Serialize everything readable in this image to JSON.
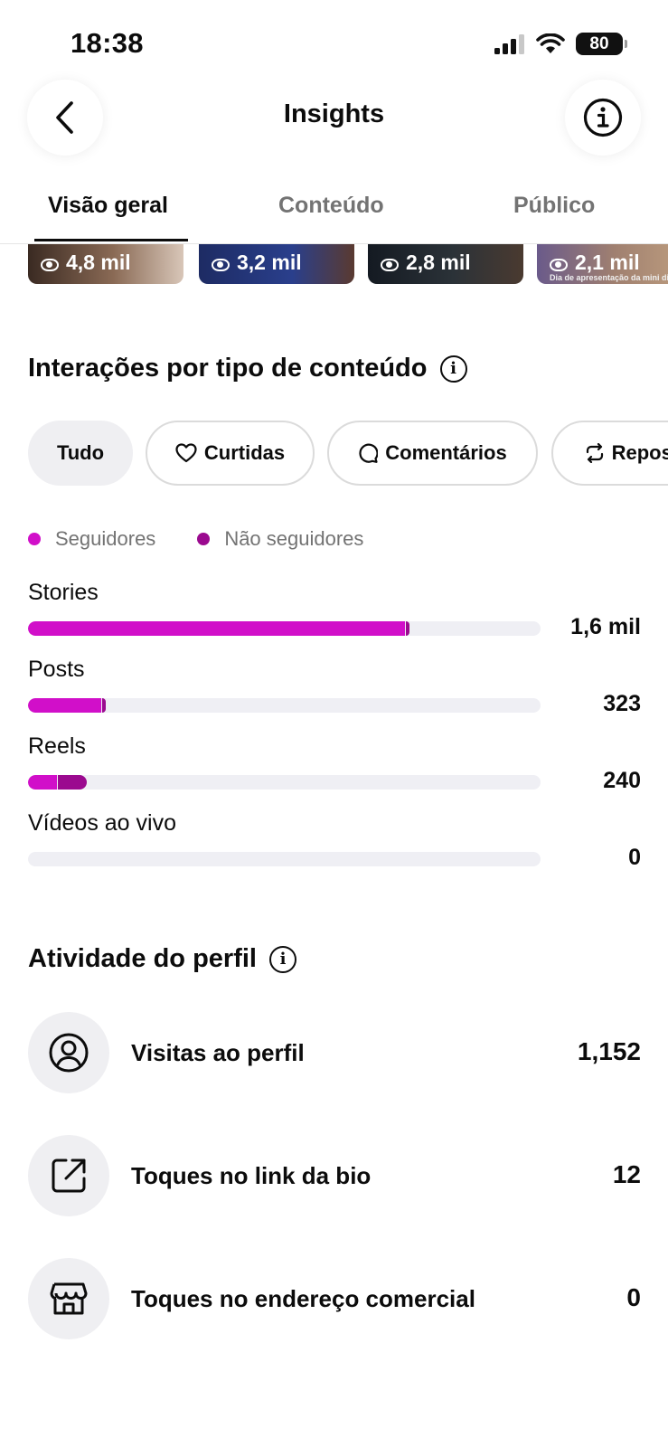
{
  "status_bar": {
    "time": "18:38",
    "battery": "80"
  },
  "header": {
    "title": "Insights"
  },
  "tabs": [
    {
      "label": "Visão geral",
      "active": true
    },
    {
      "label": "Conteúdo",
      "active": false
    },
    {
      "label": "Público",
      "active": false
    }
  ],
  "thumbnails": [
    {
      "views": "4,8 mil",
      "caption": ""
    },
    {
      "views": "3,2 mil",
      "caption": ""
    },
    {
      "views": "2,8 mil",
      "caption": ""
    },
    {
      "views": "2,1 mil",
      "caption": "Dia de apresentação da mini diva"
    }
  ],
  "interactions": {
    "title": "Interações por tipo de conteúdo",
    "filters": [
      {
        "label": "Tudo",
        "icon": "",
        "active": true
      },
      {
        "label": "Curtidas",
        "icon": "heart-icon",
        "active": false
      },
      {
        "label": "Comentários",
        "icon": "comment-icon",
        "active": false
      },
      {
        "label": "Reposts",
        "icon": "repost-icon",
        "active": false
      }
    ],
    "legend": [
      {
        "label": "Seguidores",
        "color": "#d10fc9"
      },
      {
        "label": "Não seguidores",
        "color": "#9b0a8f"
      }
    ],
    "rows": [
      {
        "label": "Stories",
        "value": "1,6 mil",
        "followers_pct": 73.5,
        "non_followers_pct": 0.6
      },
      {
        "label": "Posts",
        "value": "323",
        "followers_pct": 14.2,
        "non_followers_pct": 0.6
      },
      {
        "label": "Reels",
        "value": "240",
        "followers_pct": 5.6,
        "non_followers_pct": 5.6
      },
      {
        "label": "Vídeos ao vivo",
        "value": "0",
        "followers_pct": 0,
        "non_followers_pct": 0
      }
    ]
  },
  "profile_activity": {
    "title": "Atividade do perfil",
    "items": [
      {
        "label": "Visitas ao perfil",
        "value": "1,152",
        "icon": "user-circle-icon"
      },
      {
        "label": "Toques no link da bio",
        "value": "12",
        "icon": "external-link-icon"
      },
      {
        "label": "Toques no endereço comercial",
        "value": "0",
        "icon": "storefront-icon"
      }
    ]
  },
  "colors": {
    "followers": "#d10fc9",
    "non_followers": "#9b0a8f",
    "track": "#efeff4"
  }
}
